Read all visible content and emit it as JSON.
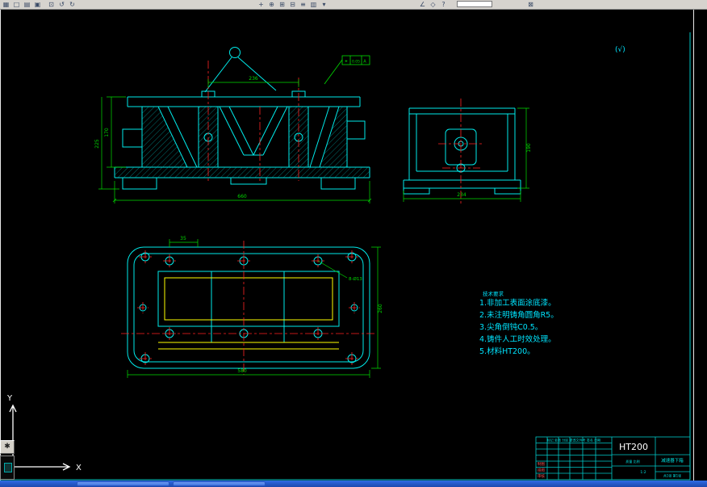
{
  "toolbar": {
    "icons": [
      {
        "name": "app-menu-icon",
        "glyph": "▦"
      },
      {
        "name": "new-file-icon",
        "glyph": "□"
      },
      {
        "name": "open-file-icon",
        "glyph": "▤"
      },
      {
        "name": "save-icon",
        "glyph": "▣"
      },
      {
        "name": "print-icon",
        "glyph": "⊡"
      },
      {
        "name": "undo-icon",
        "glyph": "↺"
      },
      {
        "name": "redo-icon",
        "glyph": "↻"
      },
      {
        "name": "pan-icon",
        "glyph": "+"
      },
      {
        "name": "zoom-realtime-icon",
        "glyph": "⊕"
      },
      {
        "name": "zoom-window-icon",
        "glyph": "⊞"
      },
      {
        "name": "zoom-previous-icon",
        "glyph": "⊟"
      },
      {
        "name": "layers-icon",
        "glyph": "≡"
      },
      {
        "name": "properties-icon",
        "glyph": "▥"
      },
      {
        "name": "measure-icon",
        "glyph": "∠"
      },
      {
        "name": "osnap-icon",
        "glyph": "◇"
      },
      {
        "name": "help-icon",
        "glyph": "?"
      },
      {
        "name": "plot-preview-icon",
        "glyph": "⊠"
      }
    ],
    "dropdown_glyph": "▾"
  },
  "drawing": {
    "surface_finish_note": "(√)",
    "axes": {
      "x": "X",
      "y": "Y"
    },
    "gdt": {
      "symbol": "⌖",
      "value": "0.05",
      "datum": "A"
    },
    "tech_notes": {
      "title": "技术要求",
      "lines": [
        "1.非加工表面涂底漆。",
        "2.未注明铸角圆角R5。",
        "3.尖角倒钝C0.5。",
        "4.铸件人工时效处理。",
        "5.材料HT200。"
      ]
    },
    "dimensions": {
      "front_top": "236",
      "front_bottom": "660",
      "front_left_a": "170",
      "front_left_b": "225",
      "side_bottom": "234",
      "side_right": "190",
      "plan_top": "35",
      "plan_bottom": "580",
      "plan_right": "260",
      "plan_holes": "8-Ø13"
    }
  },
  "title_block": {
    "material": "HT200",
    "part_name": "减速器下箱",
    "header_row": "标记 处数 分区 更改文件号 签名 日期",
    "rows": {
      "a": "制图",
      "b": "描图",
      "c": "审核"
    },
    "labels_mid": "质量  比例",
    "scale_value": "1:2",
    "sheet_info": "共1张 第1张"
  }
}
